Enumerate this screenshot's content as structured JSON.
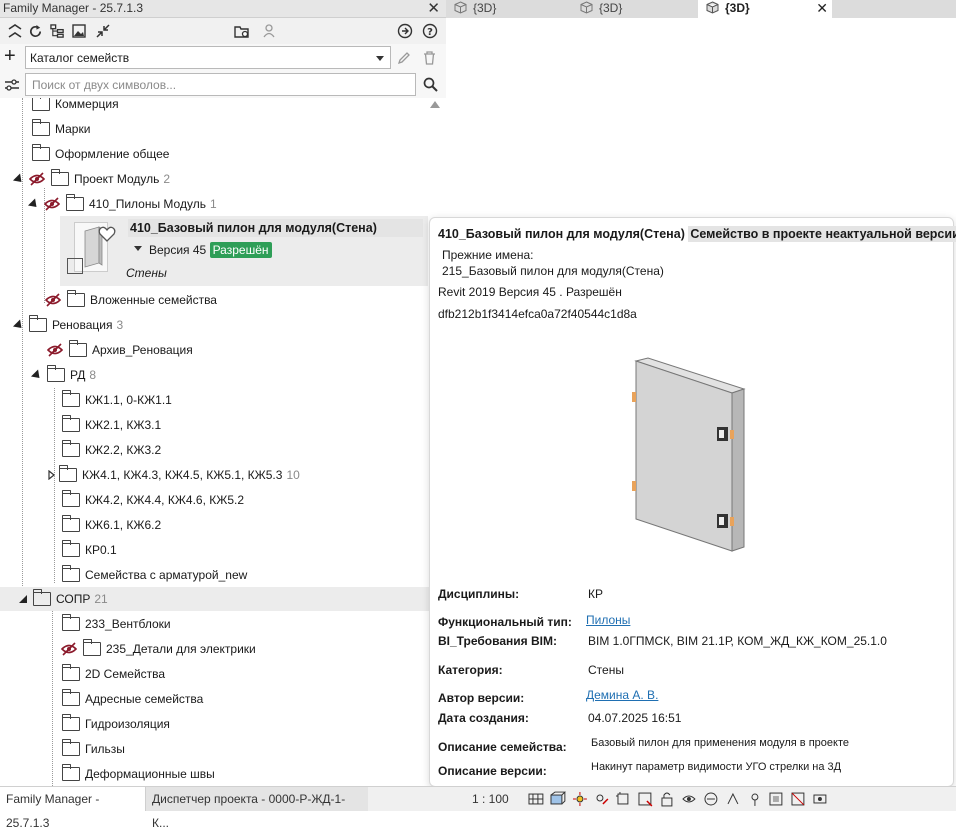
{
  "app": {
    "title": "Family Manager - 25.7.1.3",
    "close_glyph": "✕"
  },
  "toolbar": {
    "add_label": "+",
    "catalog_value": "Каталог семейств",
    "search_placeholder": "Поиск от двух символов..."
  },
  "view_tabs": [
    {
      "label": "{3D}",
      "active": false
    },
    {
      "label": "{3D}",
      "active": false
    },
    {
      "label": "{3D}",
      "active": true
    }
  ],
  "tree": {
    "items": [
      {
        "label": "Коммерция",
        "count": ""
      },
      {
        "label": "Марки",
        "count": ""
      },
      {
        "label": "Оформление общее",
        "count": ""
      },
      {
        "label": "Проект Модуль",
        "count": "2"
      },
      {
        "label": "410_Пилоны Модуль",
        "count": "1"
      },
      {
        "label": "Вложенные семейства",
        "count": ""
      },
      {
        "label": "Реновация",
        "count": "3"
      },
      {
        "label": "Архив_Реновация",
        "count": ""
      },
      {
        "label": "РД",
        "count": "8"
      },
      {
        "label": "КЖ1.1, 0-КЖ1.1",
        "count": ""
      },
      {
        "label": "КЖ2.1, КЖ3.1",
        "count": ""
      },
      {
        "label": "КЖ2.2, КЖ3.2",
        "count": ""
      },
      {
        "label": "КЖ4.1, КЖ4.3, КЖ4.5, КЖ5.1, КЖ5.3",
        "count": "10"
      },
      {
        "label": "КЖ4.2, КЖ4.4, КЖ4.6, КЖ5.2",
        "count": ""
      },
      {
        "label": "КЖ6.1, КЖ6.2",
        "count": ""
      },
      {
        "label": "КР0.1",
        "count": ""
      },
      {
        "label": "Семейства с арматурой_new",
        "count": ""
      },
      {
        "label": "СОПР",
        "count": "21"
      },
      {
        "label": "233_Вентблоки",
        "count": ""
      },
      {
        "label": "235_Детали для электрики",
        "count": ""
      },
      {
        "label": "2D Семейства",
        "count": ""
      },
      {
        "label": "Адресные семейства",
        "count": ""
      },
      {
        "label": "Гидроизоляция",
        "count": ""
      },
      {
        "label": "Гильзы",
        "count": ""
      },
      {
        "label": "Деформационные швы",
        "count": ""
      }
    ],
    "family_card": {
      "name": "410_Базовый пилон для модуля(Стена)",
      "version": "Версия 45",
      "status": "Разрешён",
      "category": "Стены"
    }
  },
  "popup": {
    "title": "410_Базовый пилон для модуля(Стена)",
    "warning": "Семейство в проекте неактуальной версии",
    "former_names_label": "Прежние имена:",
    "former_name": "215_Базовый пилон для модуля(Стена)",
    "revit_line": "Revit 2019 Версия 45 . Разрешён",
    "hash": "dfb212b1f3414efca0a72f40544c1d8a",
    "props": [
      {
        "key": "Дисциплины:",
        "value": "КР",
        "link": false
      },
      {
        "key": "Функциональный тип:",
        "value": "Пилоны",
        "link": true
      },
      {
        "key": "BI_Требования BIM:",
        "value": "BIM 1.0ГПМСК, BIM 21.1Р, КОМ_ЖД_КЖ_КОМ_25.1.0",
        "link": false
      },
      {
        "key": "Категория:",
        "value": "Стены",
        "link": false
      },
      {
        "key": "Автор версии:",
        "value": "Демина А. В.",
        "link": true
      },
      {
        "key": "Дата создания:",
        "value": "04.07.2025 16:51",
        "link": false
      },
      {
        "key": "Описание семейства:",
        "value": "Базовый пилон для применения модуля в проекте",
        "link": false
      },
      {
        "key": "Описание версии:",
        "value": "Накинут параметр видимости УГО стрелки на 3Д",
        "link": false
      }
    ]
  },
  "statusbar": {
    "tab1": "Family Manager - 25.7.1.3",
    "tab2": "Диспетчер проекта - 0000-Р-ЖД-1-К...",
    "scale": "1 : 100"
  },
  "colors": {
    "badge_green": "#2e9e57",
    "link_blue": "#1f6fb2"
  }
}
